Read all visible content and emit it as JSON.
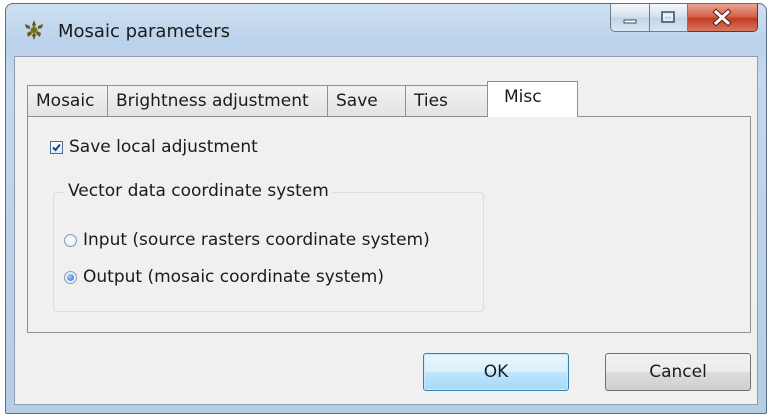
{
  "window": {
    "title": "Mosaic parameters",
    "icon": "mosaic-app-icon"
  },
  "caption_buttons": {
    "minimize": "minimize-icon",
    "maximize": "maximize-icon",
    "close": "close-icon"
  },
  "tabs": [
    {
      "label": "Mosaic",
      "active": false
    },
    {
      "label": "Brightness adjustment",
      "active": false
    },
    {
      "label": "Save",
      "active": false
    },
    {
      "label": "Ties",
      "active": false
    },
    {
      "label": "Misc",
      "active": true
    }
  ],
  "misc": {
    "save_local_adjustment": {
      "label": "Save local adjustment",
      "checked": true
    },
    "vector_group": {
      "title": "Vector data coordinate system",
      "options": [
        {
          "label": "Input (source rasters coordinate system)",
          "selected": false
        },
        {
          "label": "Output (mosaic coordinate system)",
          "selected": true
        }
      ]
    }
  },
  "buttons": {
    "ok": "OK",
    "cancel": "Cancel"
  },
  "colors": {
    "accent_selected": "#1e6fc6",
    "close_button": "#c23c24",
    "ok_button_border": "#3c7fb1"
  }
}
